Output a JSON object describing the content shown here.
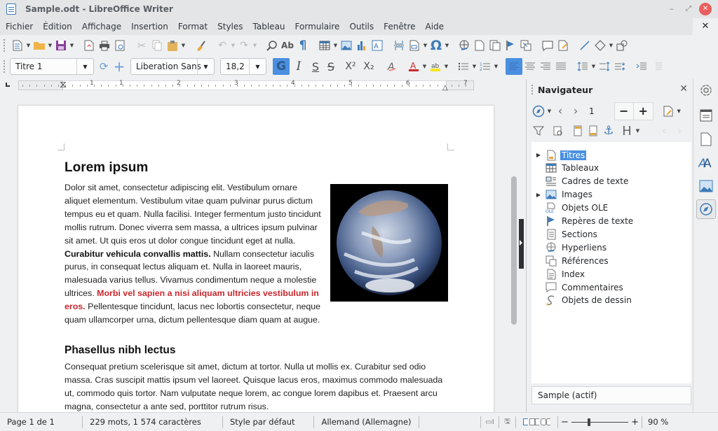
{
  "window": {
    "title": "Sample.odt - LibreOffice Writer",
    "controls": {
      "minimize": "–",
      "maximize": "⤢",
      "close": "✕"
    }
  },
  "menubar": {
    "items": [
      "Fichier",
      "Édition",
      "Affichage",
      "Insertion",
      "Format",
      "Styles",
      "Tableau",
      "Formulaire",
      "Outils",
      "Fenêtre",
      "Aide"
    ],
    "close_document": "✕"
  },
  "toolbar_standard": {
    "icons": [
      "new-document",
      "open",
      "save",
      "export-pdf",
      "print",
      "print-preview",
      "cut",
      "copy",
      "paste",
      "clone-formatting",
      "undo",
      "redo",
      "find-replace",
      "spelling",
      "formatting-marks",
      "insert-table",
      "insert-image",
      "insert-chart",
      "insert-textbox",
      "insert-page-break",
      "insert-field",
      "insert-special-character",
      "insert-hyperlink",
      "insert-footnote",
      "insert-endnote",
      "insert-bookmark",
      "insert-cross-reference",
      "insert-comment",
      "track-changes",
      "insert-line",
      "basic-shapes",
      "draw-functions"
    ],
    "special_char_glyph": "Ω"
  },
  "toolbar_formatting": {
    "paragraph_style": "Titre 1",
    "font_name": "Liberation Sans",
    "font_size": "18,2",
    "bold_label": "G",
    "italic_label": "I",
    "underline_label": "S",
    "strike_label": "S",
    "superscript_label": "X²",
    "subscript_label": "X₂",
    "bold_active": true,
    "align_left_active": true,
    "font_color": "#c9282e",
    "highlight_color": "#f5e61e",
    "accent_color": "#4a8fe0"
  },
  "ruler": {
    "labels": [
      "1",
      "1",
      "2",
      "3",
      "4",
      "5",
      "6",
      "7"
    ]
  },
  "document": {
    "heading1": "Lorem ipsum",
    "para1_part1": "Dolor sit amet, consectetur adipiscing elit. Vestibulum ornare aliquet elementum. Vestibulum vitae quam pulvinar purus dictum tempus eu et quam. Nulla facilisi. Integer fermentum justo tincidunt mollis rutrum. Donec viverra sem massa, a ultrices ipsum pulvinar sit amet. Ut quis eros ut dolor congue tincidunt eget at nulla. ",
    "para1_bold": "Curabitur vehicula convallis mattis.",
    "para1_part2": " Nullam consectetur iaculis purus, in consequat lectus aliquam et. Nulla in laoreet mauris, malesuada varius tellus. Vivamus condimentum neque a molestie ultrices. ",
    "para1_red": "Morbi vel sapien a nisi aliquam ultricies vestibulum in eros.",
    "para1_part3": " Pellentesque tincidunt, lacus nec lobortis consectetur, neque quam ullamcorper urna, dictum pellentesque diam quam at augue.",
    "image_alt": "Earth photograph",
    "heading2": "Phasellus nibh lectus",
    "para2": "Consequat pretium scelerisque sit amet, dictum at tortor. Nulla ut mollis ex. Curabitur sed odio massa. Cras suscipit mattis ipsum vel laoreet. Quisque lacus eros, maximus commodo malesuada ut, commodo quis tortor. Nam vulputate neque lorem, ac congue lorem dapibus et. Praesent arcu magna, consectetur a ante sed, porttitor rutrum risus."
  },
  "navigator": {
    "title": "Navigateur",
    "close": "✕",
    "page_number": "1",
    "minus": "−",
    "plus": "+",
    "heading_glyph": "H",
    "items": [
      {
        "label": "Titres",
        "icon": "headings",
        "expandable": true,
        "selected": true
      },
      {
        "label": "Tableaux",
        "icon": "table",
        "expandable": false,
        "selected": false
      },
      {
        "label": "Cadres de texte",
        "icon": "text-frame",
        "expandable": false,
        "selected": false
      },
      {
        "label": "Images",
        "icon": "image",
        "expandable": true,
        "selected": false
      },
      {
        "label": "Objets OLE",
        "icon": "ole-object",
        "expandable": false,
        "selected": false
      },
      {
        "label": "Repères de texte",
        "icon": "bookmark",
        "expandable": false,
        "selected": false
      },
      {
        "label": "Sections",
        "icon": "section",
        "expandable": false,
        "selected": false
      },
      {
        "label": "Hyperliens",
        "icon": "hyperlink",
        "expandable": false,
        "selected": false
      },
      {
        "label": "Références",
        "icon": "reference",
        "expandable": false,
        "selected": false
      },
      {
        "label": "Index",
        "icon": "index",
        "expandable": false,
        "selected": false
      },
      {
        "label": "Commentaires",
        "icon": "comment",
        "expandable": false,
        "selected": false
      },
      {
        "label": "Objets de dessin",
        "icon": "drawing-object",
        "expandable": false,
        "selected": false
      }
    ],
    "active_document": "Sample (actif)"
  },
  "sidebar_tabs": [
    "settings",
    "properties",
    "page",
    "styles",
    "gallery",
    "navigator"
  ],
  "statusbar": {
    "page": "Page 1 de 1",
    "word_count": "229 mots, 1 574 caractères",
    "page_style": "Style par défaut",
    "language": "Allemand (Allemagne)",
    "zoom": "90 %",
    "zoom_fraction": 0.9
  }
}
